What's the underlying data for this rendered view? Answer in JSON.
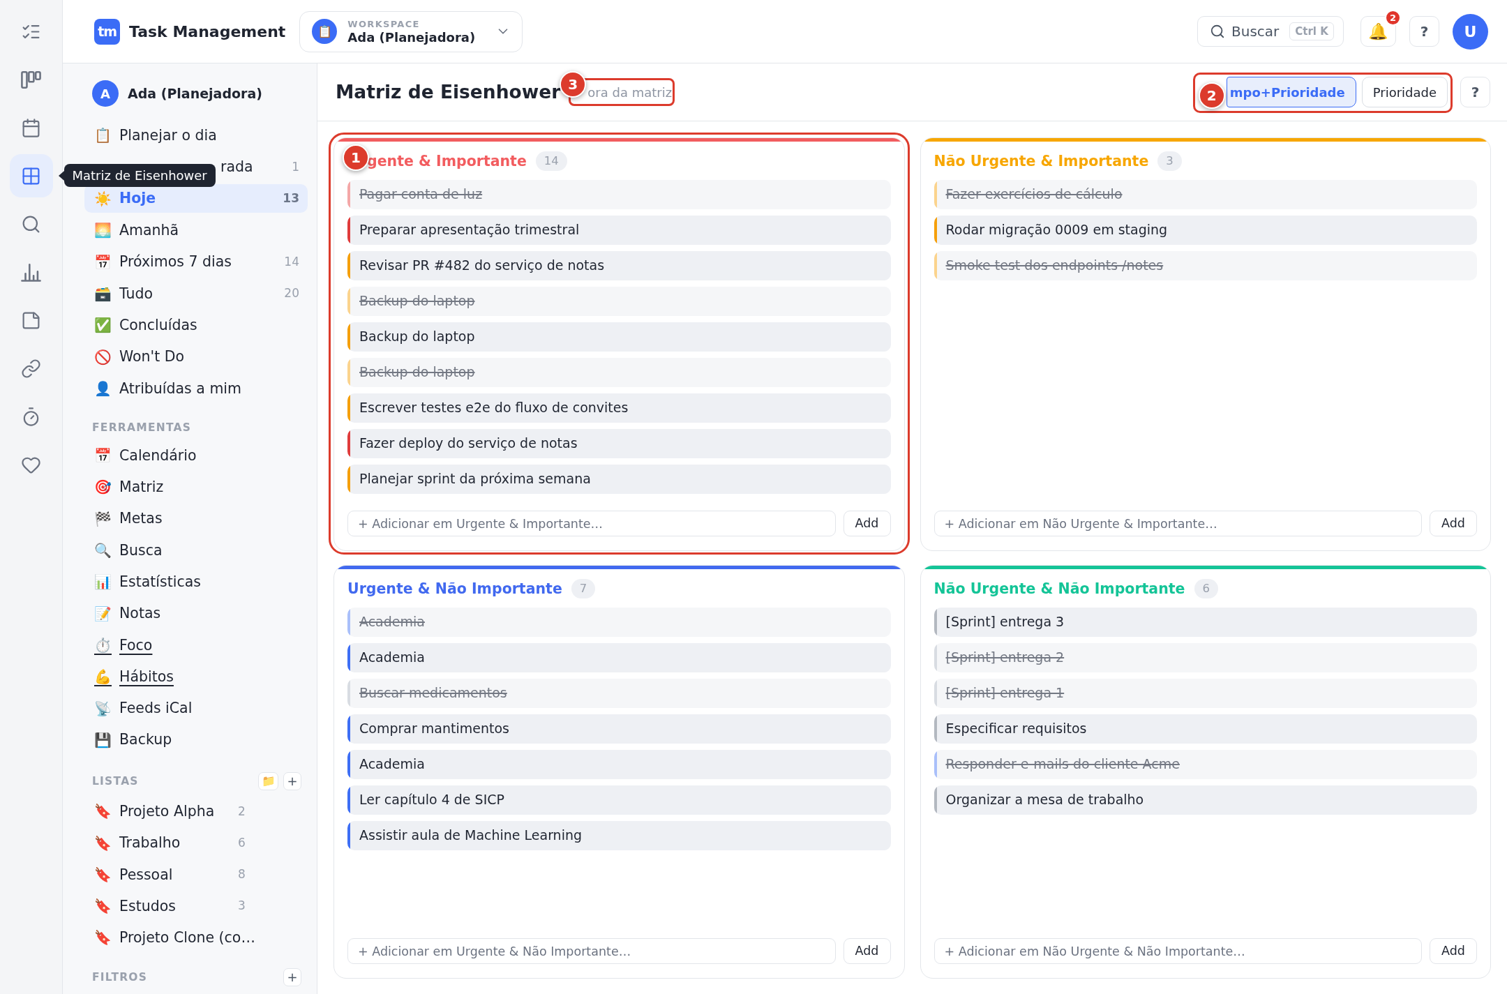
{
  "rail": {
    "items": [
      {
        "kind": "tasks",
        "selected": false
      },
      {
        "kind": "board",
        "selected": false
      },
      {
        "kind": "calendar",
        "selected": false
      },
      {
        "kind": "matrix",
        "selected": true
      },
      {
        "kind": "search",
        "selected": false
      },
      {
        "kind": "stats",
        "selected": false
      },
      {
        "kind": "notes",
        "selected": false
      },
      {
        "kind": "links",
        "selected": false
      },
      {
        "kind": "timer",
        "selected": false
      },
      {
        "kind": "favorites",
        "selected": false
      }
    ],
    "tooltip": "Matriz de Eisenhower"
  },
  "header": {
    "logo": "tm",
    "app_name": "Task Management",
    "workspace": {
      "icon": "📋",
      "label": "WORKSPACE",
      "name": "Ada (Planejadora)"
    },
    "search": {
      "label": "Buscar",
      "shortcut": "Ctrl K"
    },
    "notifications": {
      "icon": "🔔",
      "badge": "2"
    },
    "help": "?",
    "avatar": "U"
  },
  "sidebar": {
    "user": {
      "initial": "A",
      "name": "Ada (Planejadora)"
    },
    "nav": [
      {
        "icon": "📋",
        "label": "Planejar o dia",
        "selected": false
      },
      {
        "label": "rada",
        "count": "1",
        "selected": false
      },
      {
        "icon": "☀️",
        "label": "Hoje",
        "count": "13",
        "selected": true
      },
      {
        "icon": "🌅",
        "label": "Amanhã",
        "selected": false
      },
      {
        "icon": "📅",
        "label": "Próximos 7 dias",
        "count": "14",
        "selected": false
      },
      {
        "icon": "🗃️",
        "label": "Tudo",
        "count": "20",
        "selected": false
      },
      {
        "icon": "✅",
        "label": "Concluídas",
        "selected": false
      },
      {
        "icon": "🚫",
        "label": "Won't Do",
        "selected": false
      },
      {
        "icon": "👤",
        "label": "Atribuídas a mim",
        "selected": false
      }
    ],
    "tools": {
      "title": "FERRAMENTAS",
      "items": [
        {
          "icon": "📅",
          "label": "Calendário",
          "underlined": false
        },
        {
          "icon": "🎯",
          "label": "Matriz",
          "underlined": false
        },
        {
          "icon": "🏁",
          "label": "Metas",
          "underlined": false
        },
        {
          "icon": "🔍",
          "label": "Busca",
          "underlined": false
        },
        {
          "icon": "📊",
          "label": "Estatísticas",
          "underlined": false
        },
        {
          "icon": "📝",
          "label": "Notas",
          "underlined": false
        },
        {
          "icon": "⏱️",
          "label": "Foco",
          "underlined": true
        },
        {
          "icon": "💪",
          "label": "Hábitos",
          "underlined": true
        },
        {
          "icon": "📡",
          "label": "Feeds iCal",
          "underlined": false
        },
        {
          "icon": "💾",
          "label": "Backup",
          "underlined": false
        }
      ]
    },
    "lists": {
      "title": "LISTAS",
      "actions": [
        "📁",
        "+"
      ],
      "items": [
        {
          "icon": "🔖",
          "label": "Projeto Alpha",
          "count": "2"
        },
        {
          "icon": "🔖",
          "label": "Trabalho",
          "count": "6"
        },
        {
          "icon": "🔖",
          "label": "Pessoal",
          "count": "8"
        },
        {
          "icon": "🔖",
          "label": "Estudos",
          "count": "3"
        },
        {
          "icon": "🔖",
          "label": "Projeto Clone (co…"
        }
      ]
    },
    "filters": {
      "title": "FILTROS",
      "actions": [
        "+"
      ]
    }
  },
  "page": {
    "title": "Matriz de Eisenhower",
    "matrix_filter": {
      "label": "ora da matriz",
      "annotation": "3"
    },
    "view_toggle": {
      "annotation": "2",
      "options": [
        {
          "label": "mpo+Prioridade",
          "selected": true
        },
        {
          "label": "Prioridade",
          "selected": false
        }
      ]
    },
    "help": "?"
  },
  "quadrants": [
    {
      "title": "gente & Importante",
      "count": "14",
      "color": "#f25c5f",
      "annotation": "1",
      "tasks": [
        {
          "title": "Pagar conta de luz",
          "done": true,
          "color": "#f4a7a7"
        },
        {
          "title": "Preparar apresentação trimestral",
          "done": false,
          "color": "#e03b3b"
        },
        {
          "title": "Revisar PR #482 do serviço de notas",
          "done": false,
          "color": "#f59f0b"
        },
        {
          "title": "Backup do laptop",
          "done": true,
          "color": "#fbd38d"
        },
        {
          "title": "Backup do laptop",
          "done": false,
          "color": "#f59f0b"
        },
        {
          "title": "Backup do laptop",
          "done": true,
          "color": "#fbd38d"
        },
        {
          "title": "Escrever testes e2e do fluxo de convites",
          "done": false,
          "color": "#f59f0b"
        },
        {
          "title": "Fazer deploy do serviço de notas",
          "done": false,
          "color": "#e03b3b"
        },
        {
          "title": "Planejar sprint da próxima semana",
          "done": false,
          "color": "#f59f0b"
        }
      ],
      "placeholder": "+ Adicionar em Urgente & Importante…",
      "add_label": "Add"
    },
    {
      "title": "Não Urgente & Importante",
      "count": "3",
      "color": "#f7a600",
      "tasks": [
        {
          "title": "Fazer exercícios de cálculo",
          "done": true,
          "color": "#fbd38d"
        },
        {
          "title": "Rodar migração 0009 em staging",
          "done": false,
          "color": "#f59f0b"
        },
        {
          "title": "Smoke test dos endpoints /notes",
          "done": true,
          "color": "#fbd38d"
        }
      ],
      "placeholder": "+ Adicionar em Não Urgente & Importante…",
      "add_label": "Add"
    },
    {
      "title": "Urgente & Não Importante",
      "count": "7",
      "color": "#4169ef",
      "tasks": [
        {
          "title": "Academia",
          "done": true,
          "color": "#a9bffa"
        },
        {
          "title": "Academia",
          "done": false,
          "color": "#3d6ef5"
        },
        {
          "title": "Buscar medicamentos",
          "done": true,
          "color": "#d8dce2"
        },
        {
          "title": "Comprar mantimentos",
          "done": false,
          "color": "#3d6ef5"
        },
        {
          "title": "Academia",
          "done": false,
          "color": "#3d6ef5"
        },
        {
          "title": "Ler capítulo 4 de SICP",
          "done": false,
          "color": "#3d6ef5"
        },
        {
          "title": "Assistir aula de Machine Learning",
          "done": false,
          "color": "#3d6ef5"
        }
      ],
      "placeholder": "+ Adicionar em Urgente & Não Importante…",
      "add_label": "Add"
    },
    {
      "title": "Não Urgente & Não Importante",
      "count": "6",
      "color": "#14c497",
      "tasks": [
        {
          "title": "[Sprint] entrega 3",
          "done": false,
          "color": "#b3b8c0"
        },
        {
          "title": "[Sprint] entrega 2",
          "done": true,
          "color": "#d8dce2"
        },
        {
          "title": "[Sprint] entrega 1",
          "done": true,
          "color": "#d8dce2"
        },
        {
          "title": "Especificar requisitos",
          "done": false,
          "color": "#b3b8c0"
        },
        {
          "title": "Responder e-mails do cliente Acme",
          "done": true,
          "color": "#a9bffa"
        },
        {
          "title": "Organizar a mesa de trabalho",
          "done": false,
          "color": "#b3b8c0"
        }
      ],
      "placeholder": "+ Adicionar em Não Urgente & Não Importante…",
      "add_label": "Add"
    }
  ]
}
